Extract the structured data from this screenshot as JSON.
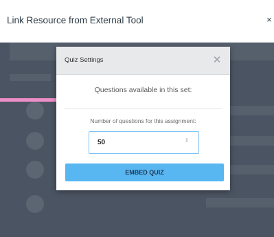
{
  "outer_modal": {
    "title": "Link Resource from External Tool",
    "close_glyph": "×"
  },
  "annotation": {
    "arrow_color": "#ee8ec8"
  },
  "quiz_settings": {
    "title": "Quiz Settings",
    "close_glyph": "✕",
    "questions_available_text": "Questions available in this set:",
    "count_label": "Number of questions for this assignment:",
    "count_value": "50",
    "spinner_glyph": "⇕",
    "embed_button_label": "EMBED QUIZ",
    "accent_color": "#58b6f1"
  }
}
